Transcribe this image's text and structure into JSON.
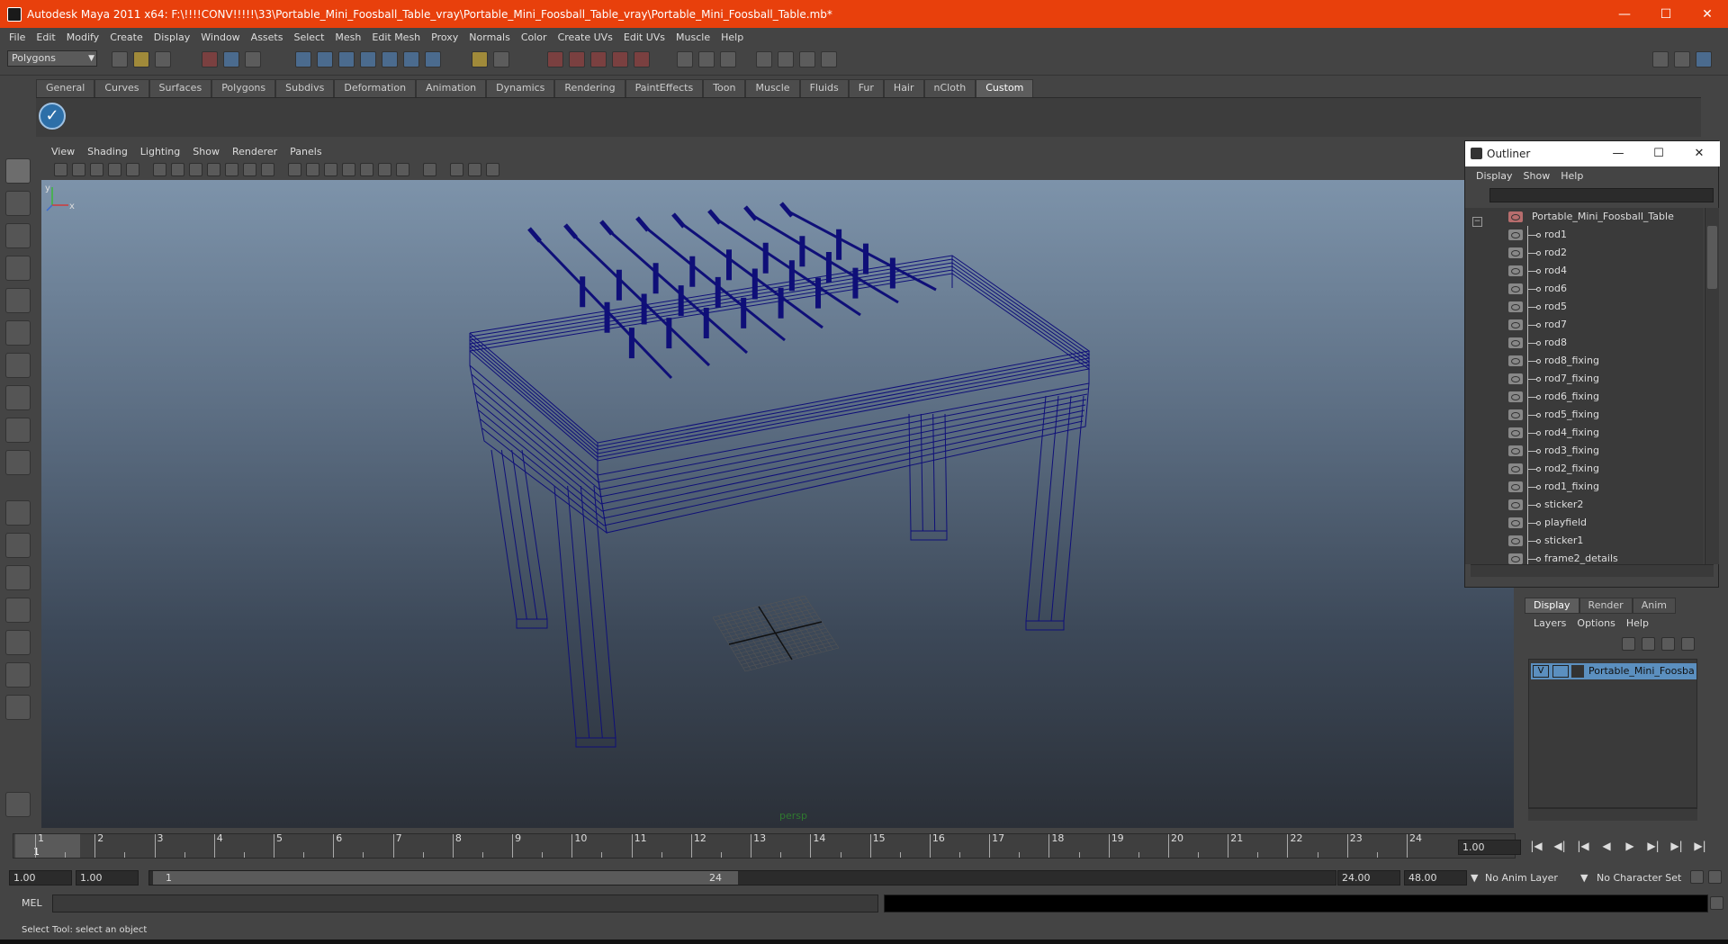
{
  "window": {
    "title": "Autodesk Maya 2011 x64: F:\\!!!!CONV!!!!!\\33\\Portable_Mini_Foosball_Table_vray\\Portable_Mini_Foosball_Table_vray\\Portable_Mini_Foosball_Table.mb*",
    "minimize": "—",
    "maximize": "☐",
    "close": "✕"
  },
  "menubar": [
    "File",
    "Edit",
    "Modify",
    "Create",
    "Display",
    "Window",
    "Assets",
    "Select",
    "Mesh",
    "Edit Mesh",
    "Proxy",
    "Normals",
    "Color",
    "Create UVs",
    "Edit UVs",
    "Muscle",
    "Help"
  ],
  "statusline": {
    "mode": "Polygons"
  },
  "shelf": {
    "tabs": [
      "General",
      "Curves",
      "Surfaces",
      "Polygons",
      "Subdivs",
      "Deformation",
      "Animation",
      "Dynamics",
      "Rendering",
      "PaintEffects",
      "Toon",
      "Muscle",
      "Fluids",
      "Fur",
      "Hair",
      "nCloth",
      "Custom"
    ],
    "active_tab": "Custom"
  },
  "viewport": {
    "menu": [
      "View",
      "Shading",
      "Lighting",
      "Show",
      "Renderer",
      "Panels"
    ],
    "camera_label": "persp",
    "axis_y": "y",
    "axis_x": "x",
    "wire_color": "#0f0f78"
  },
  "outliner": {
    "title": "Outliner",
    "menu": [
      "Display",
      "Show",
      "Help"
    ],
    "collapse": "−",
    "root": "Portable_Mini_Foosball_Table",
    "items": [
      "rod1",
      "rod2",
      "rod4",
      "rod6",
      "rod5",
      "rod7",
      "rod8",
      "rod8_fixing",
      "rod7_fixing",
      "rod6_fixing",
      "rod5_fixing",
      "rod4_fixing",
      "rod3_fixing",
      "rod2_fixing",
      "rod1_fixing",
      "sticker2",
      "playfield",
      "sticker1",
      "frame2_details"
    ]
  },
  "layer_editor": {
    "tabs": [
      "Display",
      "Render",
      "Anim"
    ],
    "active_tab": "Display",
    "menu": [
      "Layers",
      "Options",
      "Help"
    ],
    "layer_visible": "V",
    "layer_name": "Portable_Mini_Foosball_Table",
    "layer_color": "#5b8fbf"
  },
  "timeslider": {
    "ticks": [
      "1",
      "2",
      "3",
      "4",
      "5",
      "6",
      "7",
      "8",
      "9",
      "10",
      "11",
      "12",
      "13",
      "14",
      "15",
      "16",
      "17",
      "18",
      "19",
      "20",
      "21",
      "22",
      "23",
      "24"
    ],
    "current_frame": "1",
    "current_time": "1.00"
  },
  "playback": [
    "|◀",
    "◀|",
    "|◀",
    "◀",
    "▶",
    "▶|",
    "▶|",
    "▶|"
  ],
  "rangebar": {
    "start_time": "1.00",
    "playback_start": "1.00",
    "range_start": "1",
    "range_end": "24",
    "playback_end": "24.00",
    "end_time": "48.00",
    "anim_layer": "No Anim Layer",
    "character_set": "No Character Set"
  },
  "cmdline": {
    "label": "MEL"
  },
  "helpline": {
    "text": "Select Tool: select an object"
  }
}
